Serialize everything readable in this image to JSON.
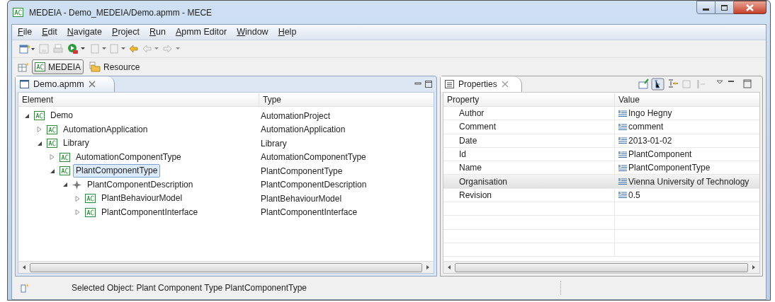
{
  "window": {
    "title": "MEDEIA - Demo_MEDEIA/Demo.apmm - MECE"
  },
  "menu": [
    "File",
    "Edit",
    "Navigate",
    "Project",
    "Run",
    "Apmm Editor",
    "Window",
    "Help"
  ],
  "perspectives": [
    {
      "label": "MEDEIA",
      "selected": true
    },
    {
      "label": "Resource",
      "selected": false
    }
  ],
  "editor": {
    "tab": "Demo.apmm",
    "columns": [
      "Element",
      "Type"
    ],
    "tree": [
      {
        "label": "Demo",
        "type": "AutomationProject",
        "kind": "component",
        "expanded": true,
        "selected": false,
        "children": [
          {
            "label": "AutomationApplication",
            "type": "AutomationApplication",
            "kind": "component",
            "expanded": false,
            "selected": false
          },
          {
            "label": "Library",
            "type": "Library",
            "kind": "component",
            "expanded": true,
            "selected": false,
            "children": [
              {
                "label": "AutomationComponentType",
                "type": "AutomationComponentType",
                "kind": "component",
                "expanded": false,
                "selected": false
              },
              {
                "label": "PlantComponentType",
                "type": "PlantComponentType",
                "kind": "component",
                "expanded": true,
                "selected": true,
                "children": [
                  {
                    "label": "PlantComponentDescription",
                    "type": "PlantComponentDescription",
                    "kind": "description",
                    "expanded": true,
                    "selected": false,
                    "children": [
                      {
                        "label": "PlantBehaviourModel",
                        "type": "PlantBehaviourModel",
                        "kind": "component",
                        "expanded": false,
                        "selected": false
                      },
                      {
                        "label": "PlantComponentInterface",
                        "type": "PlantComponentInterface",
                        "kind": "component",
                        "expanded": false,
                        "selected": false
                      }
                    ]
                  }
                ]
              }
            ]
          }
        ]
      }
    ]
  },
  "properties": {
    "tab": "Properties",
    "columns": [
      "Property",
      "Value"
    ],
    "rows": [
      {
        "property": "Author",
        "value": "Ingo Hegny",
        "selected": false
      },
      {
        "property": "Comment",
        "value": "comment",
        "selected": false
      },
      {
        "property": "Date",
        "value": "2013-01-02",
        "selected": false
      },
      {
        "property": "Id",
        "value": "PlantComponent",
        "selected": false
      },
      {
        "property": "Name",
        "value": "PlantComponentType",
        "selected": false
      },
      {
        "property": "Organisation",
        "value": "Vienna University of Technology",
        "selected": true
      },
      {
        "property": "Revision",
        "value": "0.5",
        "selected": false
      }
    ]
  },
  "status_bar": {
    "text": "Selected Object: Plant Component Type PlantComponentType"
  }
}
